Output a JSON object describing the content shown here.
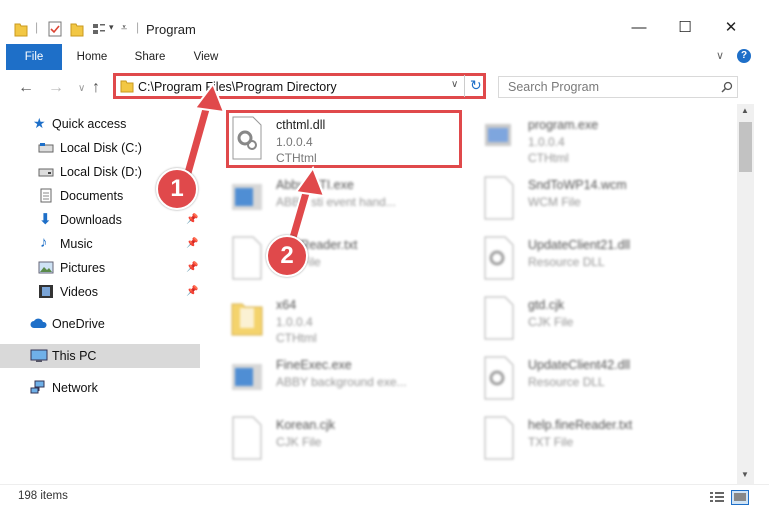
{
  "window": {
    "title": "Program",
    "minimize": "—",
    "maximize": "☐",
    "close": "✕"
  },
  "ribbon": {
    "tabs": [
      "File",
      "Home",
      "Share",
      "View"
    ],
    "expand": "∨",
    "help": "?"
  },
  "address": {
    "path": "C:\\Program Files\\Program Directory",
    "search_placeholder": "Search Program"
  },
  "sidebar": {
    "items": [
      {
        "label": "Quick access"
      },
      {
        "label": "Local Disk (C:)"
      },
      {
        "label": "Local Disk (D:)"
      },
      {
        "label": "Documents"
      },
      {
        "label": "Downloads"
      },
      {
        "label": "Music"
      },
      {
        "label": "Pictures"
      },
      {
        "label": "Videos"
      },
      {
        "label": "OneDrive"
      },
      {
        "label": "This PC"
      },
      {
        "label": "Network"
      }
    ]
  },
  "files": [
    {
      "name": "cthtml.dll",
      "l2": "1.0.0.4",
      "l3": "CTHtml"
    },
    {
      "name": "program.exe",
      "l2": "1.0.0.4",
      "l3": "CTHtml"
    },
    {
      "name": "AbbyySTI.exe",
      "l2": "ABBY sti event hand...",
      "l3": ""
    },
    {
      "name": "SndToWP14.wcm",
      "l2": "WCM File",
      "l3": ""
    },
    {
      "name": "FineReader.txt",
      "l2": "Text File",
      "l3": ""
    },
    {
      "name": "UpdateClient21.dll",
      "l2": "Resource DLL",
      "l3": ""
    },
    {
      "name": "x64",
      "l2": "1.0.0.4",
      "l3": "CTHtml"
    },
    {
      "name": "gtd.cjk",
      "l2": "CJK File",
      "l3": ""
    },
    {
      "name": "FineExec.exe",
      "l2": "ABBY background exe...",
      "l3": ""
    },
    {
      "name": "UpdateClient42.dll",
      "l2": "Resource DLL",
      "l3": ""
    },
    {
      "name": "Korean.cjk",
      "l2": "CJK File",
      "l3": ""
    },
    {
      "name": "help.fineReader.txt",
      "l2": "TXT File",
      "l3": ""
    }
  ],
  "status": {
    "items": "198 items"
  },
  "callouts": {
    "one": "1",
    "two": "2"
  },
  "colors": {
    "accent": "#1e6fc8",
    "annotation": "#e0494b",
    "folder": "#f2c744"
  }
}
